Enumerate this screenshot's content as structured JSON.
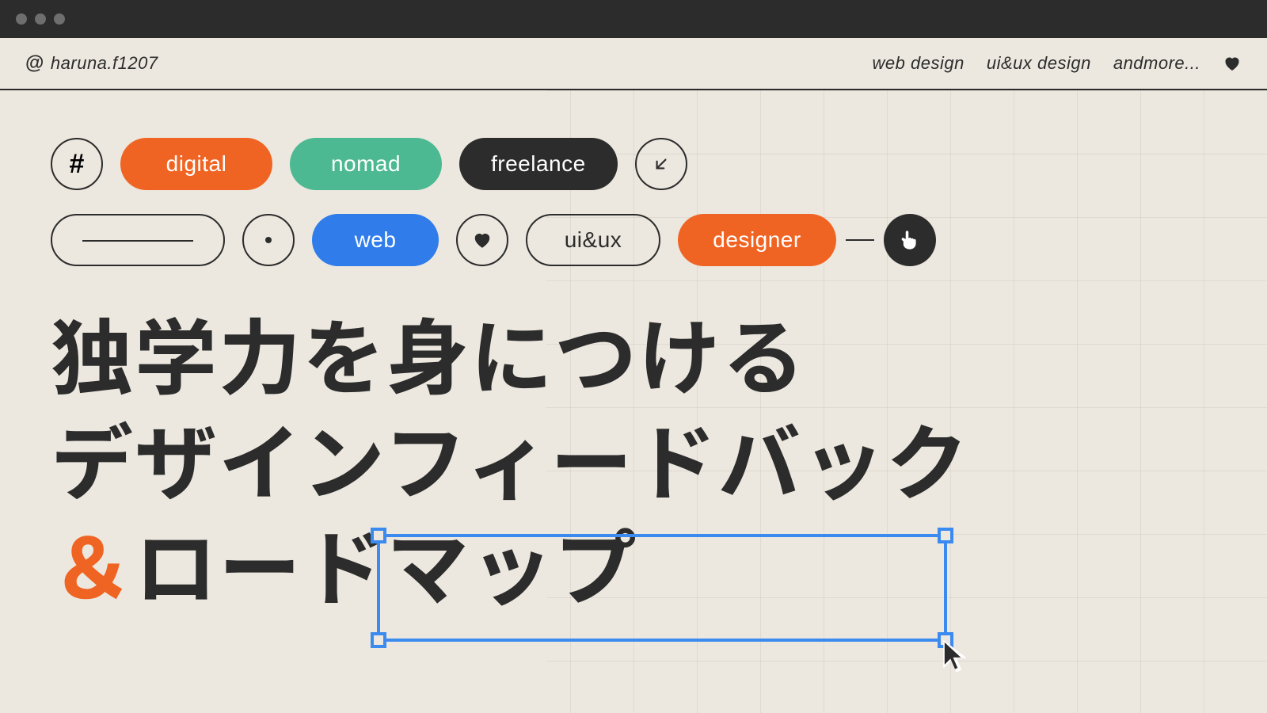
{
  "header": {
    "handle": "haruna.f1207",
    "nav": [
      "web design",
      "ui&ux design",
      "andmore..."
    ]
  },
  "tags_row1": {
    "hash": "#",
    "items": [
      {
        "label": "digital",
        "style": "orange"
      },
      {
        "label": "nomad",
        "style": "teal"
      },
      {
        "label": "freelance",
        "style": "dark"
      }
    ],
    "trailing_icon": "arrow-down-left"
  },
  "tags_row2": {
    "items": [
      {
        "label": "web",
        "style": "blue"
      },
      {
        "label": "ui&ux",
        "style": "outline"
      },
      {
        "label": "designer",
        "style": "orange"
      }
    ],
    "heart_icon": "heart",
    "trailing_icon": "pointer-hand"
  },
  "headline": {
    "line1": "独学力を身につける",
    "line2_a": "デザイン",
    "line2_b": "フィードバック",
    "amp": "＆",
    "line3": "ロードマップ"
  },
  "colors": {
    "orange": "#f06423",
    "teal": "#4cb993",
    "dark": "#2c2c2c",
    "blue": "#2f7cea",
    "selection": "#3b8af0",
    "bg": "#ece8df"
  }
}
